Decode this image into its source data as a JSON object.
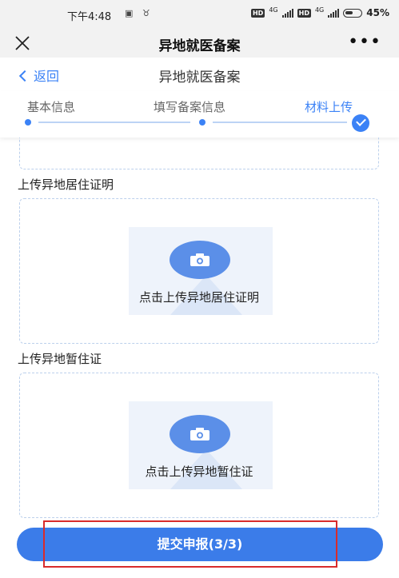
{
  "status_bar": {
    "time": "下午4:48",
    "left_icons": "▣ ♉",
    "hd_label": "HD",
    "network": "4G",
    "battery": "45%"
  },
  "app_bar": {
    "title": "异地就医备案"
  },
  "page_header": {
    "back_label": "返回",
    "title": "异地就医备案"
  },
  "stepper": {
    "steps": [
      {
        "label": "基本信息",
        "state": "completed"
      },
      {
        "label": "填写备案信息",
        "state": "completed"
      },
      {
        "label": "材料上传",
        "state": "active"
      }
    ]
  },
  "sections": [
    {
      "label": "上传异地居住证明",
      "upload_text": "点击上传异地居住证明"
    },
    {
      "label": "上传异地暂住证",
      "upload_text": "点击上传异地暂住证"
    }
  ],
  "submit": {
    "label": "提交申报(3/3)"
  },
  "colors": {
    "accent": "#3b7ce9",
    "highlight": "#d92b2b",
    "upload_border": "#bcd0ec"
  }
}
